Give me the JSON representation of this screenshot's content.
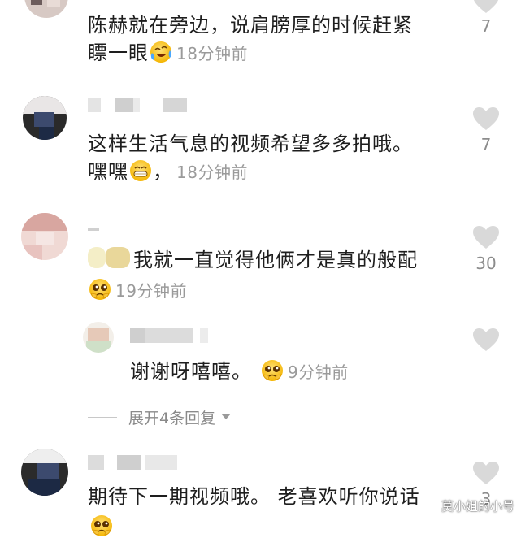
{
  "comments": [
    {
      "text_lines": [
        "陈赫就在旁边，说肩膀厚的时候赶紧",
        "瞟一眼"
      ],
      "emoji": "crying-laughing-emoji",
      "time": "18分钟前",
      "likes": "7"
    },
    {
      "text_lines": [
        "这样生活气息的视频希望多多拍哦。",
        "嘿嘿"
      ],
      "after_emoji_text": "，",
      "emoji": "grinning-emoji",
      "time": "18分钟前",
      "likes": "7"
    },
    {
      "text_lines": [
        "我就一直觉得他俩才是真的般配"
      ],
      "emoji": "pleading-emoji",
      "time": "19分钟前",
      "likes": "30"
    },
    {
      "text_lines": [
        "谢谢呀嘻嘻。"
      ],
      "emoji": "pleading-emoji",
      "time": "9分钟前",
      "likes": ""
    },
    {
      "text_lines": [
        "期待下一期视频哦。 老喜欢听你说话"
      ],
      "likes": "3"
    }
  ],
  "expand_replies": {
    "label": "展开4条回复",
    "icon": "chevron-down-icon"
  },
  "watermark": "莫小姐的小号",
  "colors": {
    "text": "#1e1e1e",
    "meta": "#9a9a9a",
    "heart": "#d9d9d9"
  }
}
